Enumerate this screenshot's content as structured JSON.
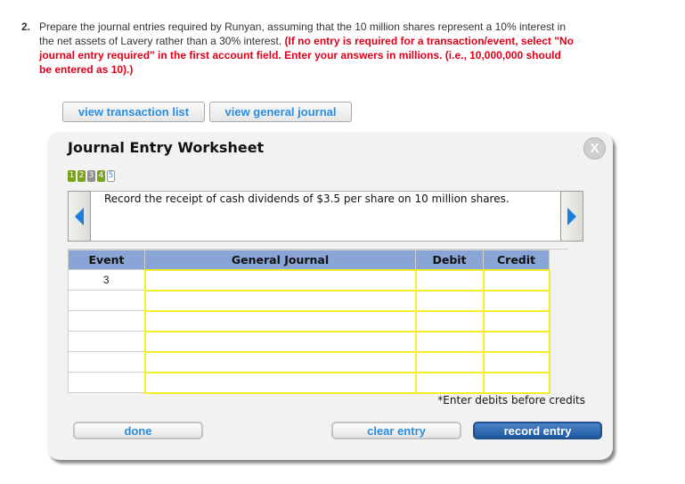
{
  "question": {
    "number": "2.",
    "text": "Prepare the journal entries required by Runyan, assuming that the 10 million shares represent a 10% interest in the net assets of Lavery rather than a 30% interest.",
    "instruction": "(If no entry is required for a transaction/event, select \"No journal entry required\" in the first account field. Enter your answers in millions. (i.e., 10,000,000 should be entered as 10).)"
  },
  "top_buttons": {
    "view_transaction_list": "view transaction list",
    "view_general_journal": "view general journal"
  },
  "worksheet": {
    "title": "Journal Entry Worksheet",
    "close_label": "X",
    "steps": [
      {
        "label": "1",
        "state": "done"
      },
      {
        "label": "2",
        "state": "done"
      },
      {
        "label": "3",
        "state": "skip"
      },
      {
        "label": "4",
        "state": "done"
      },
      {
        "label": "5",
        "state": "current"
      }
    ],
    "description": "Record the receipt of cash dividends of $3.5 per share on 10 million shares.",
    "table": {
      "headers": [
        "Event",
        "General Journal",
        "Debit",
        "Credit"
      ],
      "rows": [
        {
          "event": "3",
          "account": "",
          "debit": "",
          "credit": ""
        },
        {
          "event": "",
          "account": "",
          "debit": "",
          "credit": ""
        },
        {
          "event": "",
          "account": "",
          "debit": "",
          "credit": ""
        },
        {
          "event": "",
          "account": "",
          "debit": "",
          "credit": ""
        },
        {
          "event": "",
          "account": "",
          "debit": "",
          "credit": ""
        },
        {
          "event": "",
          "account": "",
          "debit": "",
          "credit": ""
        }
      ]
    },
    "hint": "*Enter debits before credits",
    "buttons": {
      "done": "done",
      "clear_entry": "clear entry",
      "record_entry": "record entry"
    }
  },
  "colors": {
    "accent_blue": "#2a8de0",
    "instruction_red": "#e0001b",
    "header_blue": "#89a5d6",
    "field_yellow": "#f4ee2a",
    "step_done_green": "#7aa319",
    "step_skip_gray": "#8f8f8f"
  }
}
